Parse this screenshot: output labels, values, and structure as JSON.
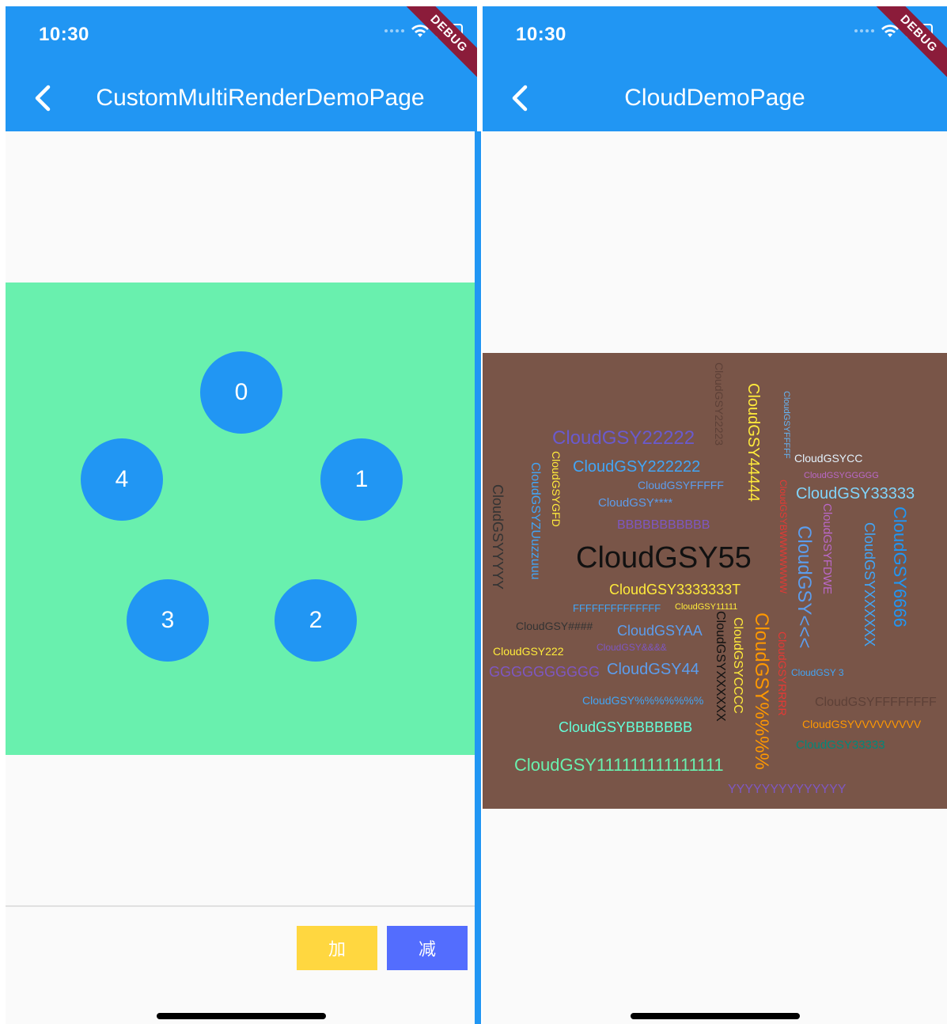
{
  "left": {
    "status_time": "10:30",
    "debug": "DEBUG",
    "title": "CustomMultiRenderDemoPage",
    "circles": [
      "0",
      "1",
      "2",
      "3",
      "4"
    ],
    "add_label": "加",
    "subtract_label": "减"
  },
  "right": {
    "status_time": "10:30",
    "debug": "DEBUG",
    "title": "CloudDemoPage",
    "words": [
      "CloudGSY55",
      "CloudGSY22222",
      "CloudGSY222222",
      "CloudGSYFFFFF",
      "CloudGSY****",
      "BBBBBBBBBBB",
      "CloudGSY3333333T",
      "FFFFFFFFFFFFFF",
      "CloudGSY11111",
      "CloudGSY####",
      "CloudGSYAA",
      "CloudGSY&&&&",
      "CloudGSY222",
      "GGGGGGGGGG",
      "CloudGSY44",
      "CloudGSY%%%%%%%",
      "CloudGSYBBBBBBB",
      "CloudGSY111111111111111",
      "YYYYYYYYYYYYYY",
      "CloudGSYCC",
      "CloudGSYGGGGG",
      "CloudGSY33333",
      "CloudGSY 3",
      "CloudGSYFFFFFFFF",
      "CloudGSYVVVVVVVVV",
      "CloudGSY33333",
      "CloudGSYYYYY",
      "CloudGSYZUuzzuuu",
      "CloudGSYGFD",
      "CloudGSY22223",
      "CloudGSY44444",
      "CloudGSYFFFFF",
      "CloudGSYBWWWWWWW",
      "CloudGSY<<<",
      "CloudGSYFDWE",
      "CloudGSYXXXXXX",
      "CloudGSY6666",
      "CloudGSYXXXXXX",
      "CloudGSYCCCC",
      "CloudGSY%%%%",
      "CloudGSYRRRR"
    ]
  },
  "colors": {
    "primary": "#2196f3",
    "green_panel": "#69f0ae",
    "cloud_bg": "#795548",
    "add_button": "#ffd740",
    "subtract_button": "#536dfe"
  }
}
